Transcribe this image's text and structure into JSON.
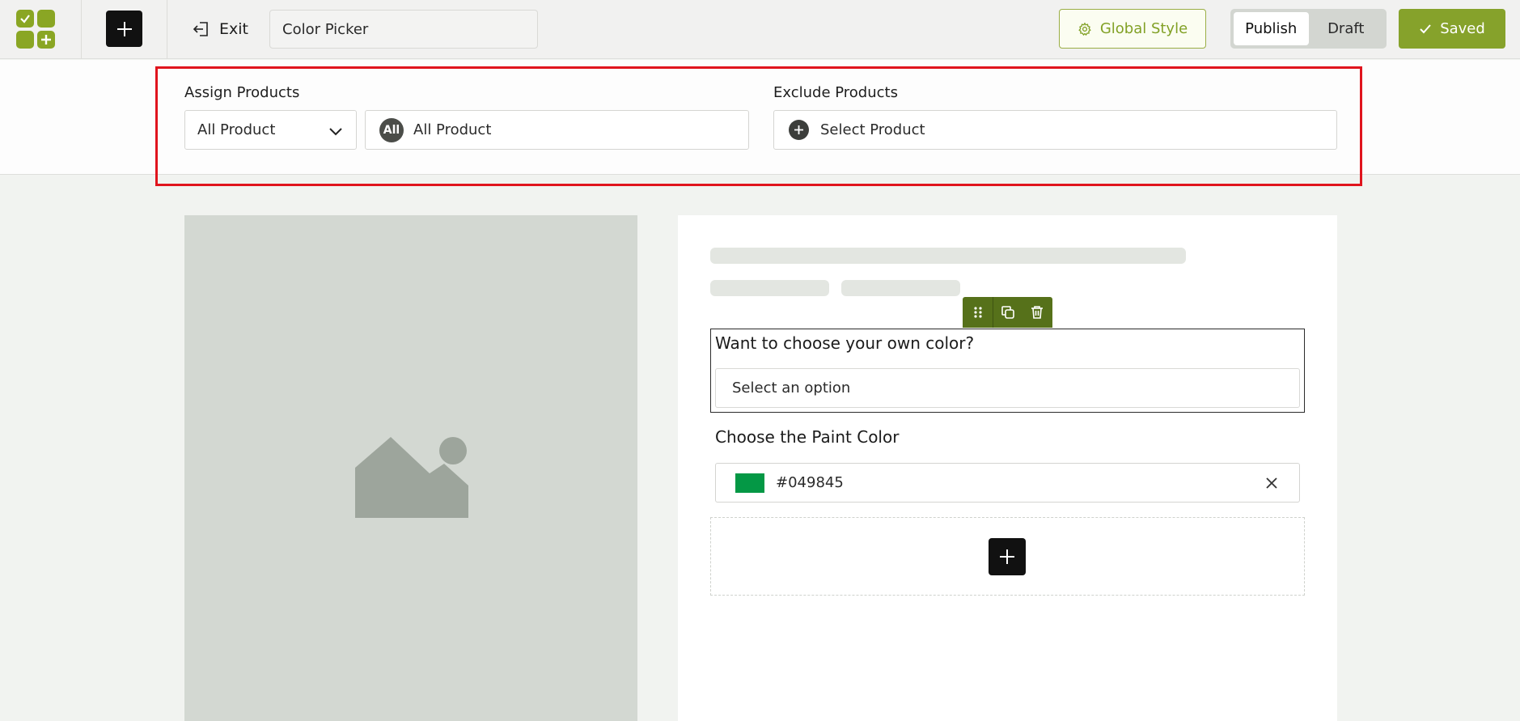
{
  "topbar": {
    "exit_label": "Exit",
    "title_value": "Color Picker",
    "global_style_label": "Global Style",
    "publish_label": "Publish",
    "draft_label": "Draft",
    "saved_label": "Saved",
    "active_mode": "Publish"
  },
  "assign": {
    "assign_label": "Assign Products",
    "assign_select_value": "All Product",
    "all_badge": "All",
    "all_product_chip": "All Product",
    "exclude_label": "Exclude Products",
    "exclude_placeholder": "Select Product"
  },
  "form": {
    "question_label": "Want to choose your own color?",
    "select_placeholder": "Select an option",
    "paint_label": "Choose the Paint Color",
    "color_value": "#049845",
    "swatch_color": "#049845"
  },
  "colors": {
    "accent": "#86a22b",
    "highlight": "#e0141d",
    "toolbar": "#56711a"
  },
  "icons": {
    "logo": "app-grid-logo-icon",
    "add": "plus-icon",
    "exit": "exit-door-icon",
    "global_style": "gear-icon",
    "saved": "check-icon",
    "dropdown": "chevron-down-icon",
    "add_product": "plus-circle-icon",
    "drag": "drag-handle-icon",
    "duplicate": "copy-icon",
    "delete": "trash-icon",
    "clear": "close-icon",
    "image_placeholder": "image-placeholder-icon"
  }
}
